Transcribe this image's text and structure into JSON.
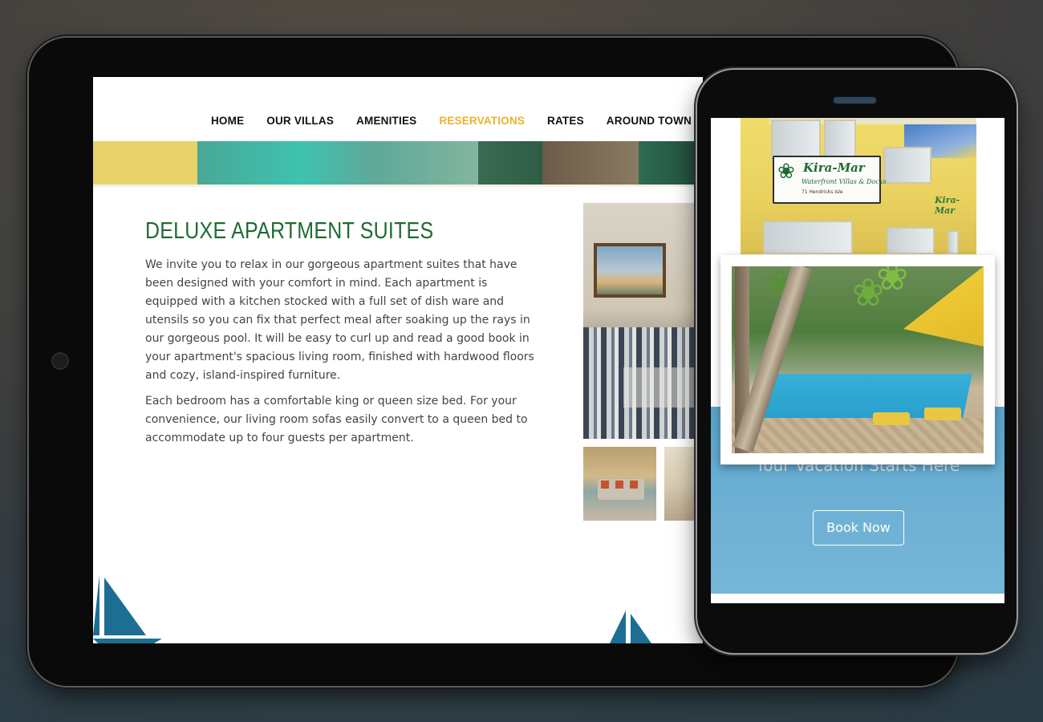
{
  "tablet": {
    "nav": [
      {
        "label": "HOME",
        "active": false
      },
      {
        "label": "OUR VILLAS",
        "active": false
      },
      {
        "label": "AMENITIES",
        "active": false
      },
      {
        "label": "RESERVATIONS",
        "active": true
      },
      {
        "label": "RATES",
        "active": false
      },
      {
        "label": "AROUND TOWN",
        "active": false
      }
    ],
    "heading": "DELUXE APARTMENT SUITES",
    "paragraphs": [
      "We invite you to relax in our gorgeous apartment suites that have been designed with your comfort in mind. Each apartment is equipped with a kitchen stocked with a full set of dish ware and utensils so you can fix that perfect meal after soaking up the rays in our gorgeous pool. It will be easy to curl up and read a good book in your apartment's spacious living room, finished with hardwood floors and cozy, island-inspired furniture.",
      "Each bedroom has a comfortable king or queen size bed. For your convenience, our living room sofas easily convert to a queen bed to accommodate up to four guests per apartment."
    ]
  },
  "phone": {
    "sign": {
      "title": "Kira-Mar",
      "subtitle": "Waterfront Villas & Docks",
      "address": "71 Hendricks Isle",
      "wall_text": "Kira-Mar"
    },
    "tagline": "Your Vacation Starts Here",
    "book_button": "Book Now"
  },
  "colors": {
    "nav_active": "#e9b32a",
    "heading_green": "#1e6b34",
    "hero_blue": "#6cb0d4",
    "sail_blue": "#1d6e93"
  }
}
